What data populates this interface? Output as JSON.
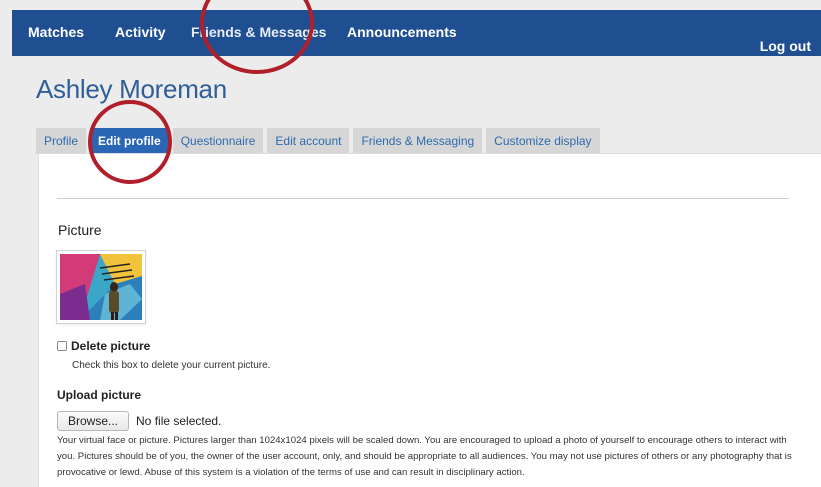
{
  "nav": {
    "items": [
      "Matches",
      "Activity",
      "Friends & Messages",
      "Announcements"
    ],
    "logout": "Log out"
  },
  "page_title": "Ashley Moreman",
  "tabs": [
    {
      "label": "Profile",
      "active": false
    },
    {
      "label": "Edit profile",
      "active": true
    },
    {
      "label": "Questionnaire",
      "active": false
    },
    {
      "label": "Edit account",
      "active": false
    },
    {
      "label": "Friends & Messaging",
      "active": false
    },
    {
      "label": "Customize display",
      "active": false
    }
  ],
  "picture": {
    "section_label": "Picture",
    "delete_label": "Delete picture",
    "delete_help": "Check this box to delete your current picture."
  },
  "upload": {
    "label": "Upload picture",
    "browse_label": "Browse...",
    "no_file": "No file selected.",
    "description": "Your virtual face or picture. Pictures larger than 1024x1024 pixels will be scaled down. You are encouraged to upload a photo of yourself to encourage others to interact with you. Pictures should be of you, the owner of the user account, only, and should be appropriate to all audiences. You may not use pictures of others or any photography that is provocative or lewd. Abuse of this system is a violation of the terms of use and can result in disciplinary action."
  },
  "colors": {
    "nav_bg": "#1f4f91",
    "accent": "#2a66b3",
    "title": "#2f5f96",
    "annotation": "#b01f2a"
  }
}
